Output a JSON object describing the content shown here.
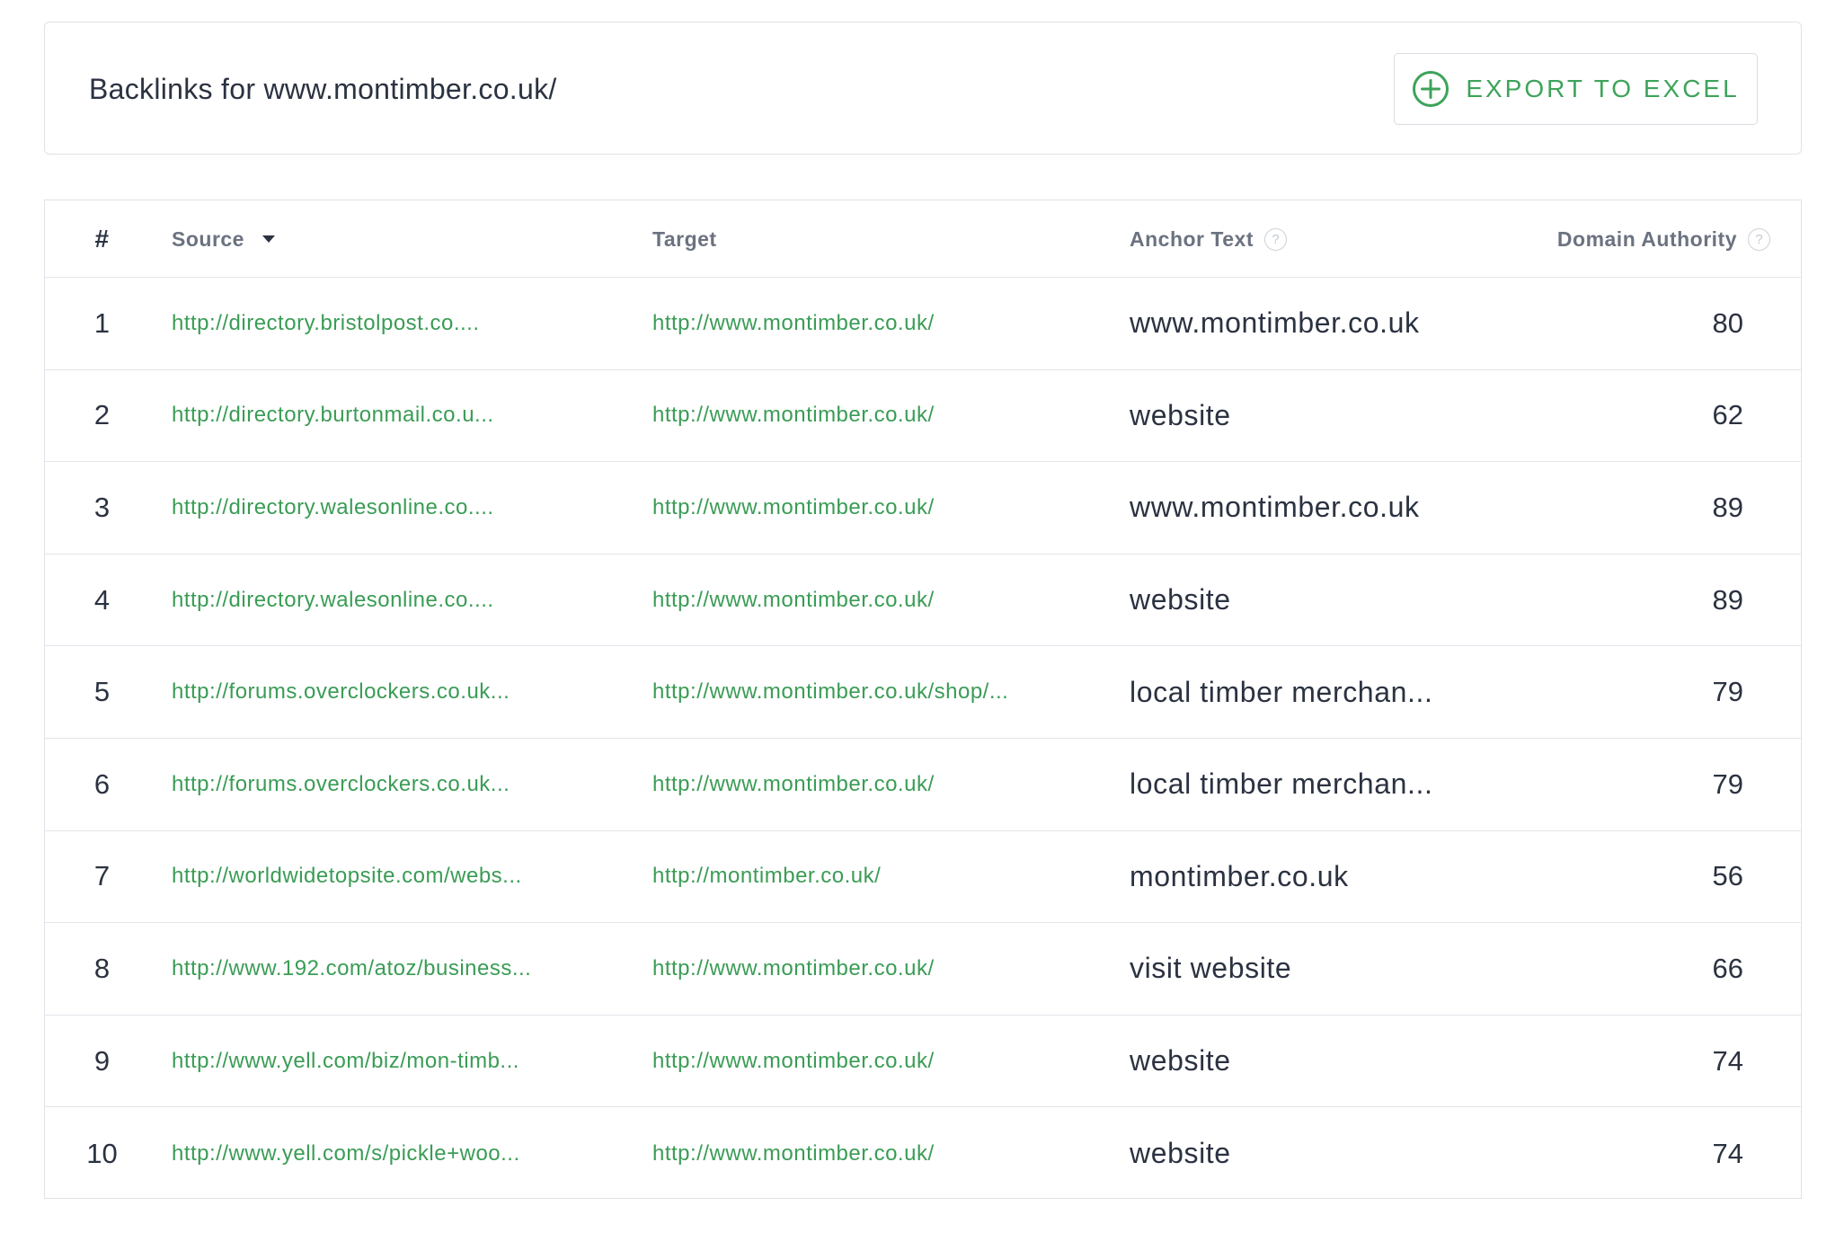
{
  "header": {
    "title": "Backlinks for www.montimber.co.uk/",
    "export_label": "EXPORT TO EXCEL",
    "export_icon": "plus-circle-icon",
    "accent_color": "#3ea35a"
  },
  "table": {
    "columns": {
      "number": "#",
      "source": "Source",
      "target": "Target",
      "anchor_text": "Anchor Text",
      "domain_authority": "Domain Authority"
    },
    "sort_column": "source",
    "sort_icon": "caret-down-icon",
    "help_icon": "question-circle-icon",
    "rows": [
      {
        "num": "1",
        "source": "http://directory.bristolpost.co....",
        "target": "http://www.montimber.co.uk/",
        "anchor": "www.montimber.co.uk",
        "da": "80"
      },
      {
        "num": "2",
        "source": "http://directory.burtonmail.co.u...",
        "target": "http://www.montimber.co.uk/",
        "anchor": "website",
        "da": "62"
      },
      {
        "num": "3",
        "source": "http://directory.walesonline.co....",
        "target": "http://www.montimber.co.uk/",
        "anchor": "www.montimber.co.uk",
        "da": "89"
      },
      {
        "num": "4",
        "source": "http://directory.walesonline.co....",
        "target": "http://www.montimber.co.uk/",
        "anchor": "website",
        "da": "89"
      },
      {
        "num": "5",
        "source": "http://forums.overclockers.co.uk...",
        "target": "http://www.montimber.co.uk/shop/...",
        "anchor": "local timber merchan...",
        "da": "79"
      },
      {
        "num": "6",
        "source": "http://forums.overclockers.co.uk...",
        "target": "http://www.montimber.co.uk/",
        "anchor": "local timber merchan...",
        "da": "79"
      },
      {
        "num": "7",
        "source": "http://worldwidetopsite.com/webs...",
        "target": "http://montimber.co.uk/",
        "anchor": "montimber.co.uk",
        "da": "56"
      },
      {
        "num": "8",
        "source": "http://www.192.com/atoz/business...",
        "target": "http://www.montimber.co.uk/",
        "anchor": "visit website",
        "da": "66"
      },
      {
        "num": "9",
        "source": "http://www.yell.com/biz/mon-timb...",
        "target": "http://www.montimber.co.uk/",
        "anchor": "website",
        "da": "74"
      },
      {
        "num": "10",
        "source": "http://www.yell.com/s/pickle+woo...",
        "target": "http://www.montimber.co.uk/",
        "anchor": "website",
        "da": "74"
      }
    ]
  }
}
